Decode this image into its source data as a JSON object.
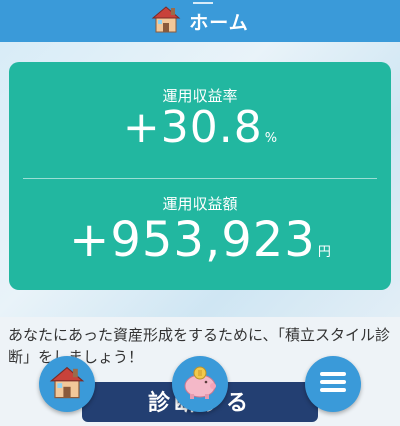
{
  "header": {
    "title": "ホーム",
    "icon": "house-icon"
  },
  "summary": {
    "rate_label": "運用収益率",
    "rate_value": "+30.8",
    "rate_unit": "%",
    "amount_label": "運用収益額",
    "amount_value": "+953,923",
    "amount_unit": "円"
  },
  "message": "あなたにあった資産形成をするために、「積立スタイル診断」をしましょう！",
  "diagnosis_button": {
    "label": "診断する"
  },
  "bottom_nav": [
    {
      "icon": "house-icon"
    },
    {
      "icon": "piggy-bank-icon"
    },
    {
      "icon": "menu-icon"
    }
  ],
  "colors": {
    "header": "#3a9ad9",
    "card": "#22b7a0",
    "button": "#233f72"
  }
}
